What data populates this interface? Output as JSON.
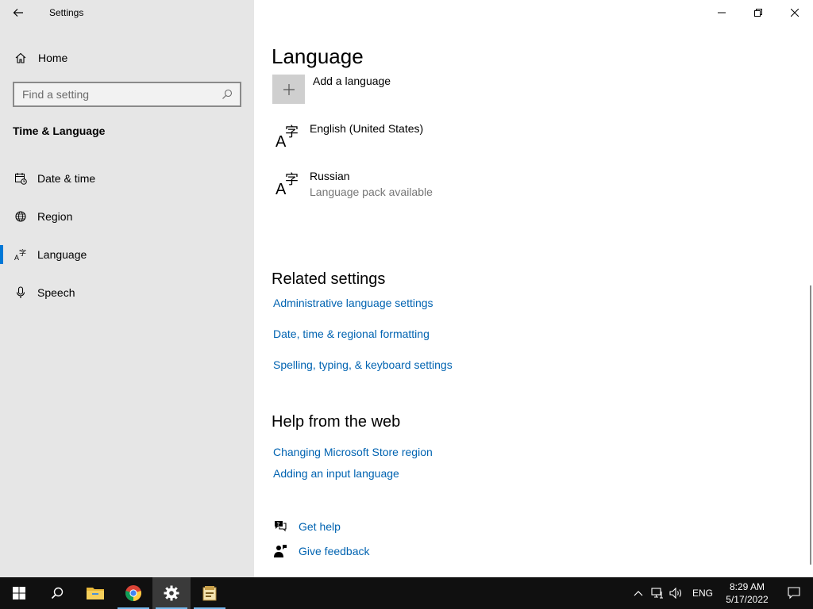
{
  "window": {
    "title": "Settings"
  },
  "sidebar": {
    "home_label": "Home",
    "search_placeholder": "Find a setting",
    "section_title": "Time & Language",
    "items": [
      {
        "label": "Date & time",
        "icon": "calendar-clock-icon"
      },
      {
        "label": "Region",
        "icon": "globe-icon"
      },
      {
        "label": "Language",
        "icon": "language-icon",
        "selected": true
      },
      {
        "label": "Speech",
        "icon": "microphone-icon"
      }
    ]
  },
  "main": {
    "title": "Language",
    "add_language_label": "Add a language",
    "languages": [
      {
        "name": "English (United States)",
        "status": ""
      },
      {
        "name": "Russian",
        "status": "Language pack available"
      }
    ],
    "related_title": "Related settings",
    "related_links": [
      "Administrative language settings",
      "Date, time & regional formatting",
      "Spelling, typing, & keyboard settings"
    ],
    "help_title": "Help from the web",
    "help_links": [
      "Changing Microsoft Store region",
      "Adding an input language"
    ],
    "get_help_label": "Get help",
    "give_feedback_label": "Give feedback"
  },
  "taskbar": {
    "apps": [
      "start-icon",
      "search-icon",
      "file-explorer-icon",
      "chrome-icon",
      "settings-icon",
      "app-icon"
    ],
    "active_app": "settings-icon",
    "input_language": "ENG",
    "time": "8:29 AM",
    "date": "5/17/2022"
  },
  "colors": {
    "accent": "#0078d7",
    "link": "#0063b1",
    "sidebar_bg": "#e6e6e6",
    "taskbar_bg": "#101010"
  }
}
